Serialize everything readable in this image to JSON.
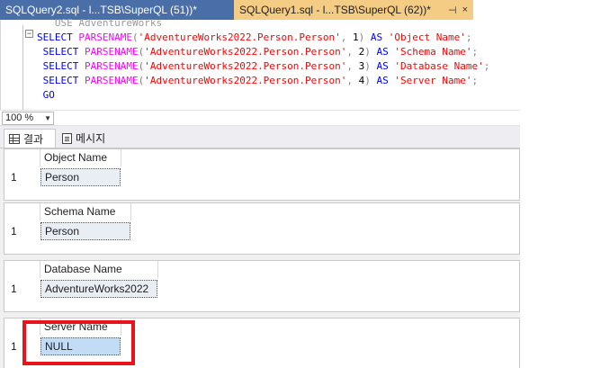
{
  "tabs": [
    {
      "label": "SQLQuery2.sql - l...TSB\\SuperQL (51))*"
    },
    {
      "label": "SQLQuery1.sql - l...TSB\\SuperQL (62))*",
      "pin": "⊣",
      "close": "×"
    }
  ],
  "editor": {
    "cut_line": "   USE AdventureWorks",
    "lines": [
      {
        "kw1": "SELECT",
        "fn": "PARSENAME",
        "str": "'AdventureWorks2022.Person.Person'",
        "num": "1",
        "kw2": "AS",
        "alias": "'Object Name'"
      },
      {
        "kw1": "SELECT",
        "fn": "PARSENAME",
        "str": "'AdventureWorks2022.Person.Person'",
        "num": "2",
        "kw2": "AS",
        "alias": "'Schema Name'"
      },
      {
        "kw1": "SELECT",
        "fn": "PARSENAME",
        "str": "'AdventureWorks2022.Person.Person'",
        "num": "3",
        "kw2": "AS",
        "alias": "'Database Name'"
      },
      {
        "kw1": "SELECT",
        "fn": "PARSENAME",
        "str": "'AdventureWorks2022.Person.Person'",
        "num": "4",
        "kw2": "AS",
        "alias": "'Server Name'"
      }
    ],
    "go": "GO"
  },
  "zoom": {
    "value": "100 %"
  },
  "result_tabs": {
    "results": "결과",
    "messages": "메시지"
  },
  "results": [
    {
      "column": "Object Name",
      "row_num": "1",
      "value": "Person"
    },
    {
      "column": "Schema Name",
      "row_num": "1",
      "value": "Person"
    },
    {
      "column": "Database Name",
      "row_num": "1",
      "value": "AdventureWorks2022"
    },
    {
      "column": "Server Name",
      "row_num": "1",
      "value": "NULL"
    }
  ],
  "colors": {
    "highlight": "#e8141b",
    "active_tab": "#f5cc84",
    "tab_bar": "#3d5f8f"
  }
}
